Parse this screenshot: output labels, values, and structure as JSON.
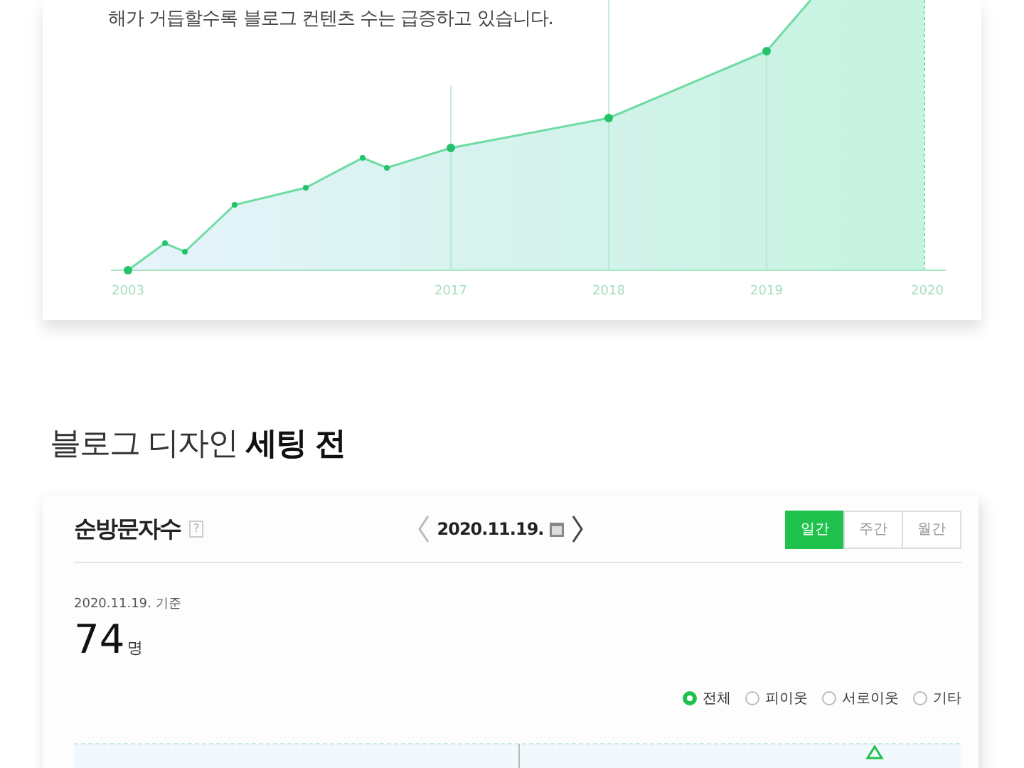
{
  "growth_card": {
    "caption": "해가 거듭할수록 블로그 컨텐츠 수는 급증하고 있습니다.",
    "x_labels": [
      "2003",
      "2017",
      "2018",
      "2019",
      "2020"
    ]
  },
  "section_heading": "블로그 디자인 **세팅 전**",
  "stats_panel": {
    "title": "순방문자수",
    "help": "?",
    "date": "2020.11.19.",
    "periods": [
      {
        "label": "일간",
        "selected": true
      },
      {
        "label": "주간",
        "selected": false
      },
      {
        "label": "월간",
        "selected": false
      }
    ],
    "basis": "2020.11.19. 기준",
    "count": "74",
    "unit": "명",
    "filters": [
      {
        "label": "전체",
        "selected": true
      },
      {
        "label": "피이웃",
        "selected": false
      },
      {
        "label": "서로이웃",
        "selected": false
      },
      {
        "label": "기타",
        "selected": false
      }
    ]
  }
}
